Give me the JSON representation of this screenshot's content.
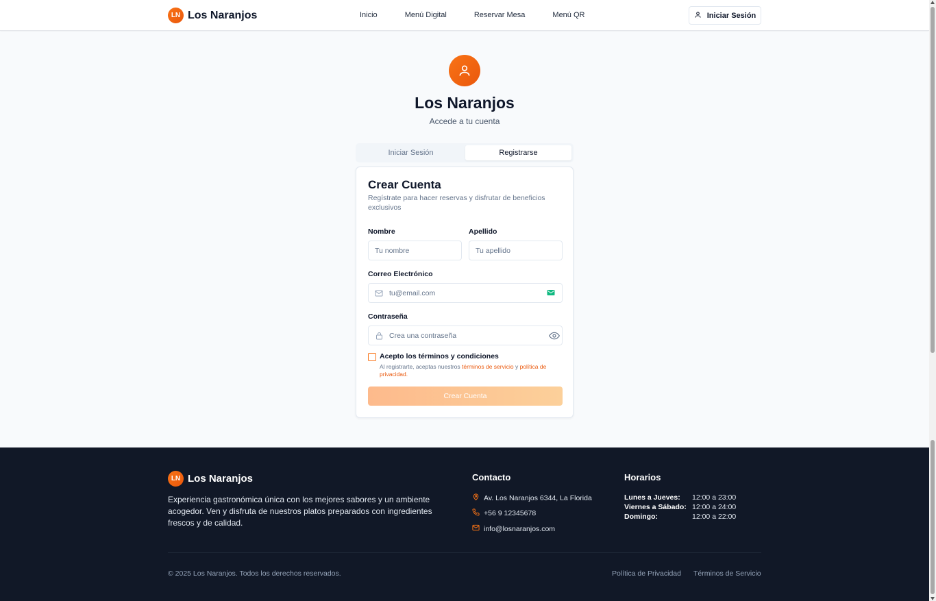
{
  "colors": {
    "brand": "#f97316",
    "brand_dark": "#ea580c",
    "footer_bg": "#111827",
    "page_bg": "#f8fafc"
  },
  "header": {
    "logo_initials": "LN",
    "brand_name": "Los Naranjos",
    "nav": [
      "Inicio",
      "Menú Digital",
      "Reservar Mesa",
      "Menú QR"
    ],
    "login_label": "Iniciar Sesión",
    "login_icon": "user-icon"
  },
  "hero": {
    "icon": "user-icon",
    "title": "Los Naranjos",
    "subtitle": "Accede a tu cuenta"
  },
  "tabs": {
    "items": [
      "Iniciar Sesión",
      "Registrarse"
    ],
    "active": "Registrarse"
  },
  "form": {
    "title": "Crear Cuenta",
    "description": "Regístrate para hacer reservas y disfrutar de beneficios exclusivos",
    "first_name": {
      "label": "Nombre",
      "placeholder": "Tu nombre",
      "value": ""
    },
    "last_name": {
      "label": "Apellido",
      "placeholder": "Tu apellido",
      "value": ""
    },
    "email": {
      "label": "Correo Electrónico",
      "placeholder": "tu@email.com",
      "value": "",
      "icon": "mail-icon"
    },
    "password": {
      "label": "Contraseña",
      "placeholder": "Crea una contraseña",
      "value": "",
      "icon": "lock-icon",
      "toggle_icon": "eye-icon"
    },
    "terms": {
      "checked": false,
      "label": "Acepto los términos y condiciones",
      "note_prefix": "Al registrarte, aceptas nuestros ",
      "terms_link": "términos de servicio",
      "note_and": " y ",
      "privacy_link": "política de privacidad",
      "note_suffix": "."
    },
    "submit_label": "Crear Cuenta"
  },
  "footer": {
    "logo_initials": "LN",
    "brand_name": "Los Naranjos",
    "description": "Experiencia gastronómica única con los mejores sabores y un ambiente acogedor. Ven y disfruta de nuestros platos preparados con ingredientes frescos y de calidad.",
    "contact": {
      "title": "Contacto",
      "address": "Av. Los Naranjos 6344, La Florida",
      "phone": "+56 9 12345678",
      "email": "info@losnaranjos.com"
    },
    "hours": {
      "title": "Horarios",
      "rows": [
        {
          "days": "Lunes a Jueves:",
          "time": "12:00 a 23:00"
        },
        {
          "days": "Viernes a Sábado:",
          "time": "12:00 a 24:00"
        },
        {
          "days": "Domingo:",
          "time": "12:00 a 22:00"
        }
      ]
    },
    "copyright": "© 2025 Los Naranjos. Todos los derechos reservados.",
    "links": [
      "Política de Privacidad",
      "Términos de Servicio"
    ]
  }
}
